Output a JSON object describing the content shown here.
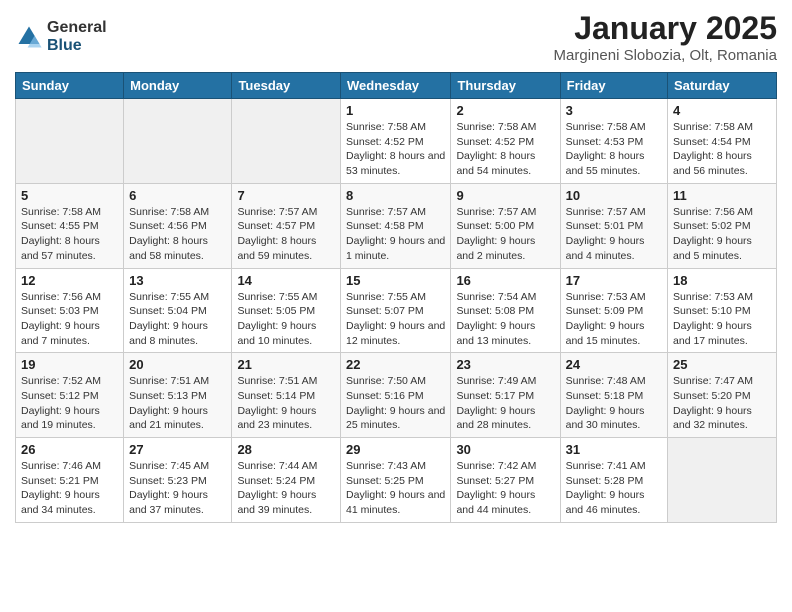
{
  "logo": {
    "general": "General",
    "blue": "Blue"
  },
  "title": "January 2025",
  "location": "Margineni Slobozia, Olt, Romania",
  "weekdays": [
    "Sunday",
    "Monday",
    "Tuesday",
    "Wednesday",
    "Thursday",
    "Friday",
    "Saturday"
  ],
  "weeks": [
    [
      {
        "day": "",
        "info": ""
      },
      {
        "day": "",
        "info": ""
      },
      {
        "day": "",
        "info": ""
      },
      {
        "day": "1",
        "info": "Sunrise: 7:58 AM\nSunset: 4:52 PM\nDaylight: 8 hours and 53 minutes."
      },
      {
        "day": "2",
        "info": "Sunrise: 7:58 AM\nSunset: 4:52 PM\nDaylight: 8 hours and 54 minutes."
      },
      {
        "day": "3",
        "info": "Sunrise: 7:58 AM\nSunset: 4:53 PM\nDaylight: 8 hours and 55 minutes."
      },
      {
        "day": "4",
        "info": "Sunrise: 7:58 AM\nSunset: 4:54 PM\nDaylight: 8 hours and 56 minutes."
      }
    ],
    [
      {
        "day": "5",
        "info": "Sunrise: 7:58 AM\nSunset: 4:55 PM\nDaylight: 8 hours and 57 minutes."
      },
      {
        "day": "6",
        "info": "Sunrise: 7:58 AM\nSunset: 4:56 PM\nDaylight: 8 hours and 58 minutes."
      },
      {
        "day": "7",
        "info": "Sunrise: 7:57 AM\nSunset: 4:57 PM\nDaylight: 8 hours and 59 minutes."
      },
      {
        "day": "8",
        "info": "Sunrise: 7:57 AM\nSunset: 4:58 PM\nDaylight: 9 hours and 1 minute."
      },
      {
        "day": "9",
        "info": "Sunrise: 7:57 AM\nSunset: 5:00 PM\nDaylight: 9 hours and 2 minutes."
      },
      {
        "day": "10",
        "info": "Sunrise: 7:57 AM\nSunset: 5:01 PM\nDaylight: 9 hours and 4 minutes."
      },
      {
        "day": "11",
        "info": "Sunrise: 7:56 AM\nSunset: 5:02 PM\nDaylight: 9 hours and 5 minutes."
      }
    ],
    [
      {
        "day": "12",
        "info": "Sunrise: 7:56 AM\nSunset: 5:03 PM\nDaylight: 9 hours and 7 minutes."
      },
      {
        "day": "13",
        "info": "Sunrise: 7:55 AM\nSunset: 5:04 PM\nDaylight: 9 hours and 8 minutes."
      },
      {
        "day": "14",
        "info": "Sunrise: 7:55 AM\nSunset: 5:05 PM\nDaylight: 9 hours and 10 minutes."
      },
      {
        "day": "15",
        "info": "Sunrise: 7:55 AM\nSunset: 5:07 PM\nDaylight: 9 hours and 12 minutes."
      },
      {
        "day": "16",
        "info": "Sunrise: 7:54 AM\nSunset: 5:08 PM\nDaylight: 9 hours and 13 minutes."
      },
      {
        "day": "17",
        "info": "Sunrise: 7:53 AM\nSunset: 5:09 PM\nDaylight: 9 hours and 15 minutes."
      },
      {
        "day": "18",
        "info": "Sunrise: 7:53 AM\nSunset: 5:10 PM\nDaylight: 9 hours and 17 minutes."
      }
    ],
    [
      {
        "day": "19",
        "info": "Sunrise: 7:52 AM\nSunset: 5:12 PM\nDaylight: 9 hours and 19 minutes."
      },
      {
        "day": "20",
        "info": "Sunrise: 7:51 AM\nSunset: 5:13 PM\nDaylight: 9 hours and 21 minutes."
      },
      {
        "day": "21",
        "info": "Sunrise: 7:51 AM\nSunset: 5:14 PM\nDaylight: 9 hours and 23 minutes."
      },
      {
        "day": "22",
        "info": "Sunrise: 7:50 AM\nSunset: 5:16 PM\nDaylight: 9 hours and 25 minutes."
      },
      {
        "day": "23",
        "info": "Sunrise: 7:49 AM\nSunset: 5:17 PM\nDaylight: 9 hours and 28 minutes."
      },
      {
        "day": "24",
        "info": "Sunrise: 7:48 AM\nSunset: 5:18 PM\nDaylight: 9 hours and 30 minutes."
      },
      {
        "day": "25",
        "info": "Sunrise: 7:47 AM\nSunset: 5:20 PM\nDaylight: 9 hours and 32 minutes."
      }
    ],
    [
      {
        "day": "26",
        "info": "Sunrise: 7:46 AM\nSunset: 5:21 PM\nDaylight: 9 hours and 34 minutes."
      },
      {
        "day": "27",
        "info": "Sunrise: 7:45 AM\nSunset: 5:23 PM\nDaylight: 9 hours and 37 minutes."
      },
      {
        "day": "28",
        "info": "Sunrise: 7:44 AM\nSunset: 5:24 PM\nDaylight: 9 hours and 39 minutes."
      },
      {
        "day": "29",
        "info": "Sunrise: 7:43 AM\nSunset: 5:25 PM\nDaylight: 9 hours and 41 minutes."
      },
      {
        "day": "30",
        "info": "Sunrise: 7:42 AM\nSunset: 5:27 PM\nDaylight: 9 hours and 44 minutes."
      },
      {
        "day": "31",
        "info": "Sunrise: 7:41 AM\nSunset: 5:28 PM\nDaylight: 9 hours and 46 minutes."
      },
      {
        "day": "",
        "info": ""
      }
    ]
  ]
}
